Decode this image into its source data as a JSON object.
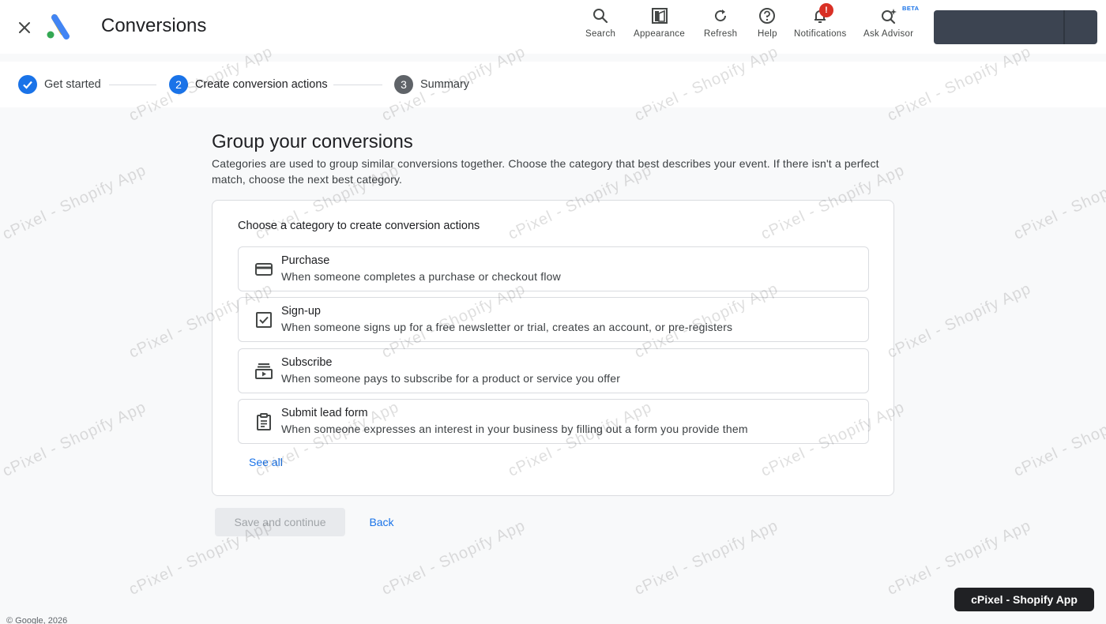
{
  "app": {
    "title": "Conversions",
    "close_icon": "close-icon",
    "logo_icon": "google-ads-logo"
  },
  "toolbar": {
    "search": "Search",
    "appearance": "Appearance",
    "refresh": "Refresh",
    "help": "Help",
    "notifications": "Notifications",
    "notifications_badge": "!",
    "ask_advisor": "Ask Advisor",
    "beta": "BETA"
  },
  "stepper": {
    "steps": [
      {
        "label": "Get started",
        "state": "done"
      },
      {
        "number": "2",
        "label": "Create conversion actions",
        "state": "active"
      },
      {
        "number": "3",
        "label": "Summary",
        "state": "pending"
      }
    ]
  },
  "main": {
    "heading": "Group your conversions",
    "description": "Categories are used to group similar conversions together. Choose the category that best describes your event. If there isn't a perfect match, choose the next best category.",
    "card_title": "Choose a category to create conversion actions",
    "options": [
      {
        "icon": "credit-card-icon",
        "title": "Purchase",
        "desc": "When someone completes a purchase or checkout flow"
      },
      {
        "icon": "checkbox-icon",
        "title": "Sign-up",
        "desc": "When someone signs up for a free newsletter or trial, creates an account, or pre-registers"
      },
      {
        "icon": "subscriptions-icon",
        "title": "Subscribe",
        "desc": "When someone pays to subscribe for a product or service you offer"
      },
      {
        "icon": "clipboard-icon",
        "title": "Submit lead form",
        "desc": "When someone expresses an interest in your business by filling out a form you provide them"
      }
    ],
    "see_all": "See all"
  },
  "actions": {
    "save": "Save and continue",
    "back": "Back"
  },
  "footer": "© Google, 2026",
  "watermark": {
    "text": "cPixel - Shopify App",
    "badge": "cPixel - Shopify App"
  },
  "colors": {
    "accent": "#1a73e8",
    "step_done": "#1a73e8",
    "step_pending": "#5f6368",
    "badge": "#d93025"
  }
}
